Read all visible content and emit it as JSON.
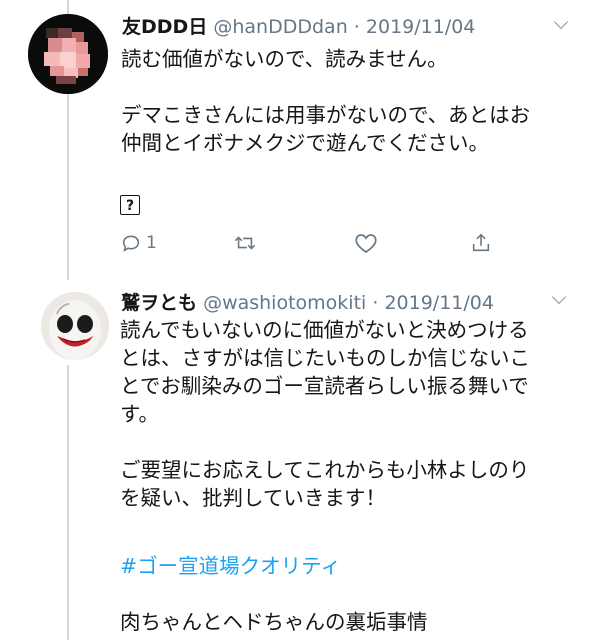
{
  "tweet1": {
    "name": "友DDD日",
    "handle": "@hanDDDdan",
    "separator": "·",
    "date": "2019/11/04",
    "body": "読む価値がないので、読みません。\n\nデマこきさんには用事がないので、あとはお\n仲間とイボナメクジで遊んでください。",
    "unknown_char": "?",
    "reply_count": "1",
    "icons": [
      "reply-icon",
      "retweet-icon",
      "like-icon",
      "share-icon",
      "chevron-down-icon"
    ]
  },
  "tweet2": {
    "name": "鷲ヲとも",
    "handle": "@washiotomokiti",
    "separator": "·",
    "date": "2019/11/04",
    "body": "読んでもいないのに価値がないと決めつける\nとは、さすがは信じたいものしか信じないこ\nとでお馴染みのゴー宣読者らしい振る舞いで\nす。\n\nご要望にお応えしてこれからも小林よしのり\nを疑い、批判していきます！",
    "hashtag": "#ゴー宣道場クオリティ",
    "body_tail": "肉ちゃんとヘドちゃんの裏垢事情",
    "icons": [
      "chevron-down-icon"
    ]
  },
  "colors": {
    "link": "#1da1f2",
    "muted": "#657786",
    "text": "#14171a",
    "thread_line": "#ccd6dd"
  }
}
